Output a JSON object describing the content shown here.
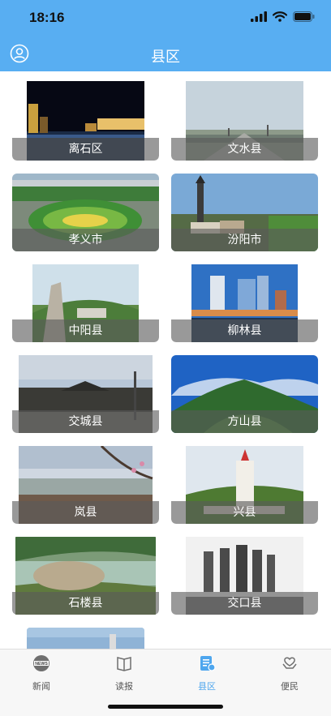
{
  "status": {
    "time": "18:16"
  },
  "nav": {
    "title": "县区"
  },
  "counties": [
    {
      "name": "离石区"
    },
    {
      "name": "文水县"
    },
    {
      "name": "孝义市"
    },
    {
      "name": "汾阳市"
    },
    {
      "name": "中阳县"
    },
    {
      "name": "柳林县"
    },
    {
      "name": "交城县"
    },
    {
      "name": "方山县"
    },
    {
      "name": "岚县"
    },
    {
      "name": "兴县"
    },
    {
      "name": "石楼县"
    },
    {
      "name": "交口县"
    }
  ],
  "tabs": [
    {
      "label": "新闻",
      "icon": "news-icon",
      "badge": "NEWS"
    },
    {
      "label": "读报",
      "icon": "newspaper-icon"
    },
    {
      "label": "县区",
      "icon": "county-icon"
    },
    {
      "label": "便民",
      "icon": "service-icon"
    }
  ],
  "colors": {
    "header": "#58aef2",
    "tab_active": "#4ea6ee",
    "tab_inactive": "#777777"
  }
}
